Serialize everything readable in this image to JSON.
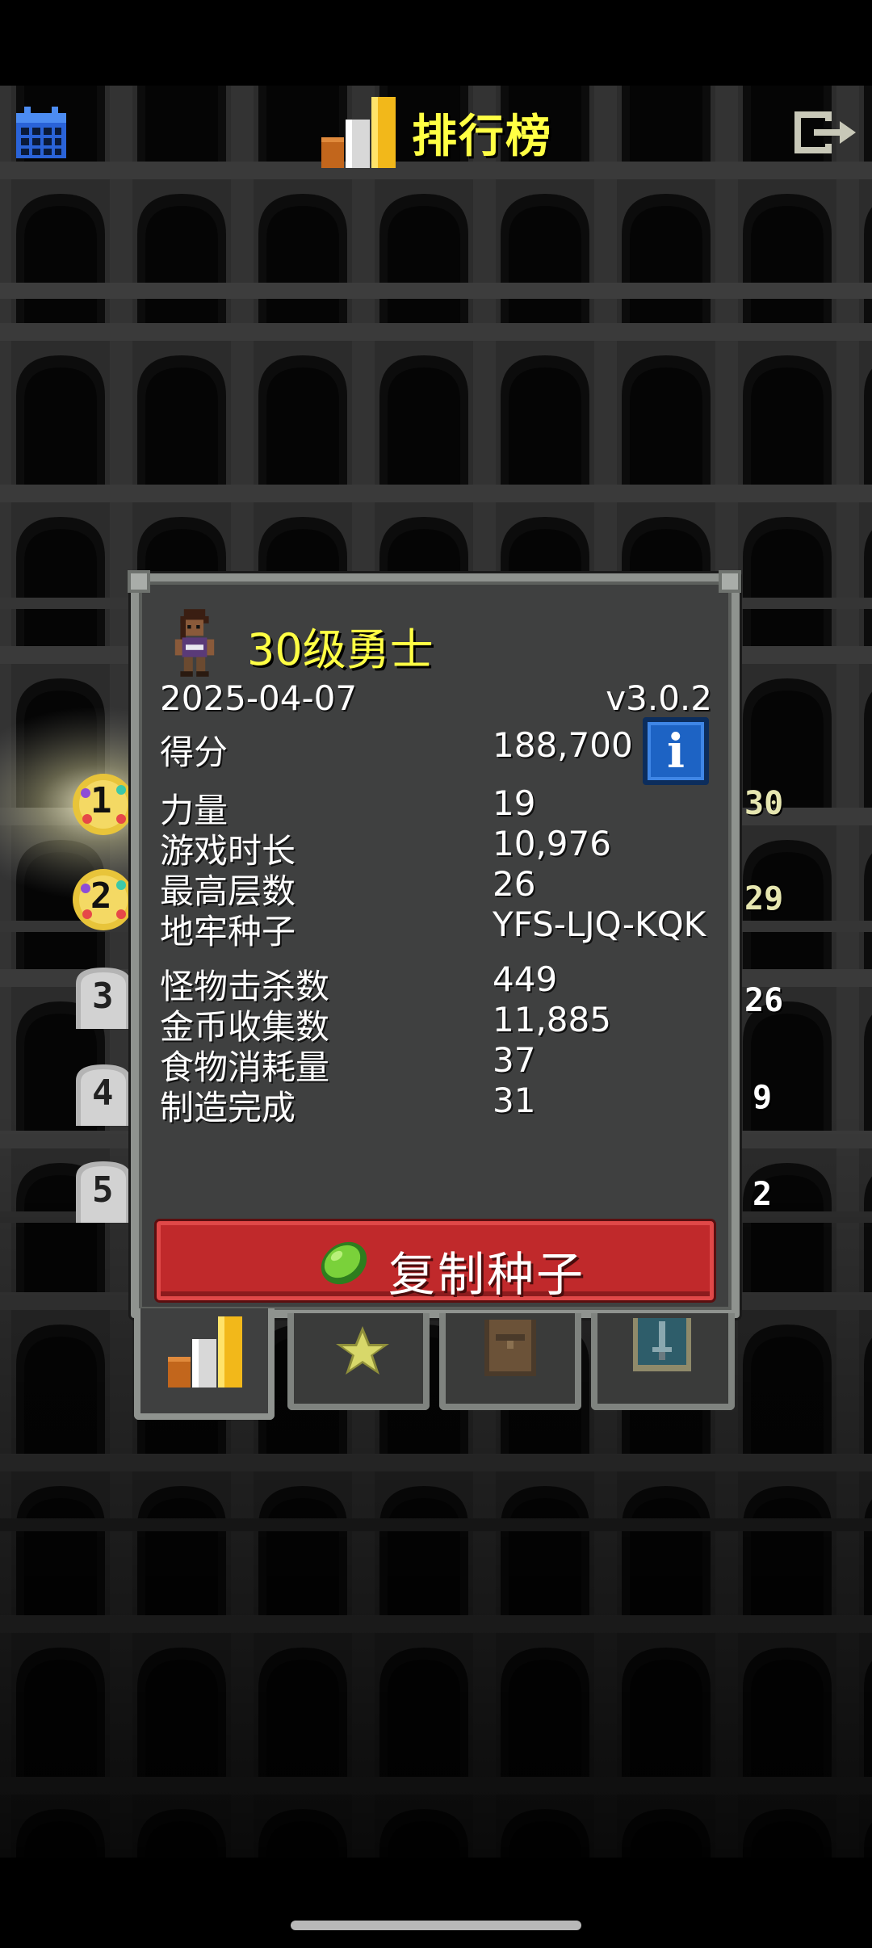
{
  "header": {
    "title": "排行榜",
    "calendar_icon": "calendar-icon",
    "exit_icon": "exit-icon",
    "title_icon": "podium-icon"
  },
  "ranks": [
    {
      "number": "1",
      "side_value": "30"
    },
    {
      "number": "2",
      "side_value": "29"
    },
    {
      "number": "3",
      "side_value": "26"
    },
    {
      "number": "4",
      "side_value": "9"
    },
    {
      "number": "5",
      "side_value": "2"
    }
  ],
  "record": {
    "hero_title": "30级勇士",
    "date": "2025-04-07",
    "version": "v3.0.2",
    "stats_group_1": [
      {
        "label": "得分",
        "value": "188,700"
      }
    ],
    "stats_group_2": [
      {
        "label": "力量",
        "value": "19"
      },
      {
        "label": "游戏时长",
        "value": "10,976"
      },
      {
        "label": "最高层数",
        "value": "26"
      },
      {
        "label": "地牢种子",
        "value": "YFS-LJQ-KQK"
      }
    ],
    "stats_group_3": [
      {
        "label": "怪物击杀数",
        "value": "449"
      },
      {
        "label": "金币收集数",
        "value": "11,885"
      },
      {
        "label": "食物消耗量",
        "value": "37"
      },
      {
        "label": "制造完成",
        "value": "31"
      }
    ],
    "copy_button_label": "复制种子"
  },
  "tabs": [
    {
      "icon": "podium-icon",
      "active": true
    },
    {
      "icon": "star-icon",
      "active": false
    },
    {
      "icon": "backpack-icon",
      "active": false
    },
    {
      "icon": "sword-badge-icon",
      "active": false
    }
  ],
  "colors": {
    "title_yellow": "#ffff44",
    "panel_bg": "#3f4040",
    "panel_border": "#8f938f",
    "button_red": "#c0292b",
    "info_blue": "#1d63c4"
  }
}
